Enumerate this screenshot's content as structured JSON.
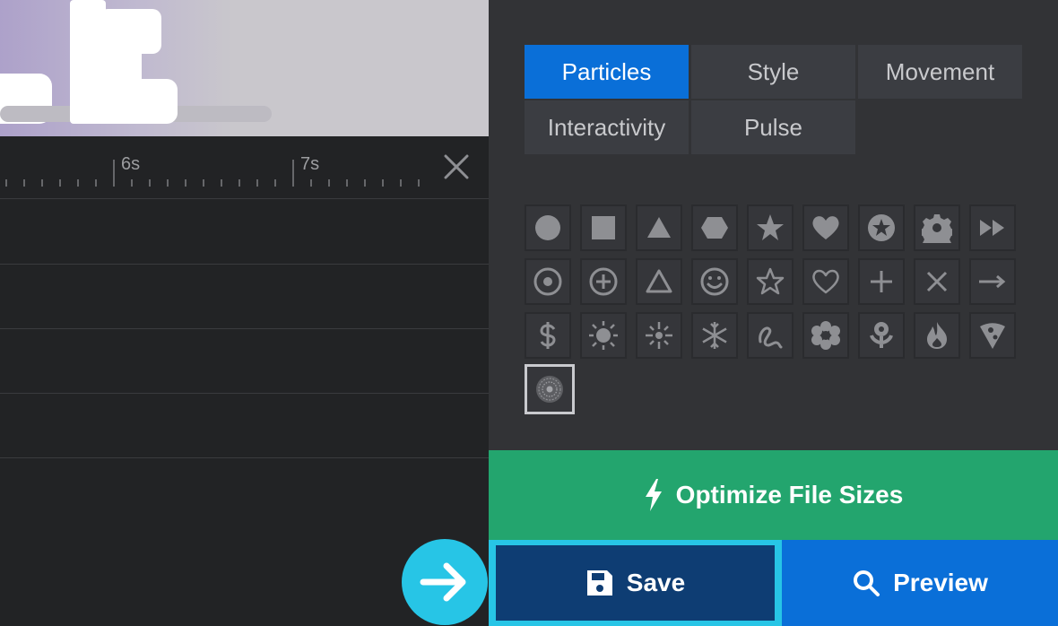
{
  "timeline": {
    "tick_labels": [
      "6s",
      "7s"
    ]
  },
  "tabs": [
    {
      "label": "Particles",
      "active": true
    },
    {
      "label": "Style",
      "active": false
    },
    {
      "label": "Movement",
      "active": false
    },
    {
      "label": "Interactivity",
      "active": false
    },
    {
      "label": "Pulse",
      "active": false
    }
  ],
  "shapes": [
    "circle-icon",
    "square-icon",
    "triangle-icon",
    "hexagon-icon",
    "star-icon",
    "heart-icon",
    "star-circle-icon",
    "gear-icon",
    "fast-forward-icon",
    "circle-dot-outline-icon",
    "circle-plus-outline-icon",
    "triangle-outline-icon",
    "smiley-outline-icon",
    "star-outline-icon",
    "heart-outline-icon",
    "plus-icon",
    "x-icon",
    "arrow-right-icon",
    "dollar-icon",
    "sun-icon",
    "sparkle-sun-icon",
    "snowflake-icon",
    "squiggle-icon",
    "flower-icon",
    "rose-icon",
    "flame-icon",
    "pizza-icon",
    "custom-image-icon"
  ],
  "selected_shape": "custom-image-icon",
  "buttons": {
    "optimize": "Optimize File Sizes",
    "save": "Save",
    "preview": "Preview"
  },
  "colors": {
    "accent_blue": "#0a6fd8",
    "optimize_green": "#23a56e",
    "save_navy": "#0e3d73",
    "highlight_cyan": "#27c5e6"
  }
}
